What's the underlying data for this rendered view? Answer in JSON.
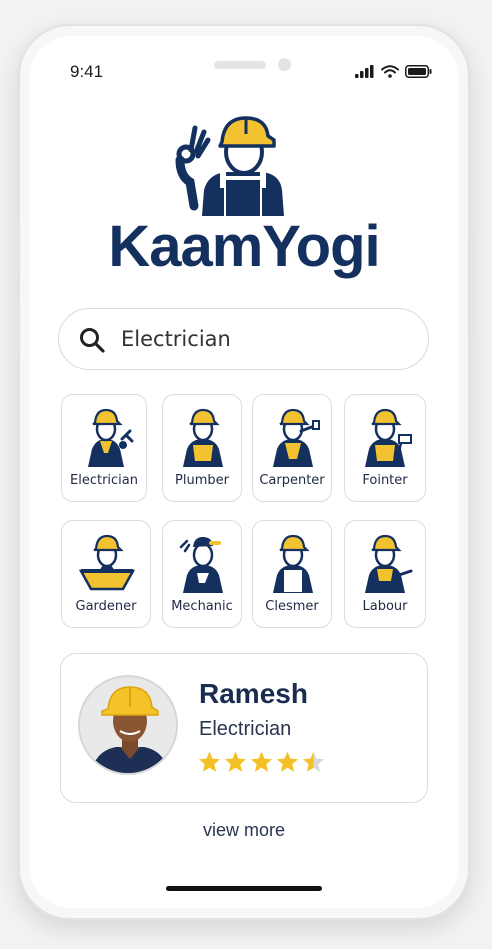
{
  "status_bar": {
    "time": "9:41"
  },
  "brand": {
    "name": "KaamYogi"
  },
  "search": {
    "value": "Electrician",
    "placeholder": "Electrician"
  },
  "categories": [
    {
      "label": "Electrician",
      "icon": "electrician-icon"
    },
    {
      "label": "Plumber",
      "icon": "plumber-icon"
    },
    {
      "label": "Carpenter",
      "icon": "carpenter-icon"
    },
    {
      "label": "Fointer",
      "icon": "painter-icon"
    },
    {
      "label": "Gardener",
      "icon": "gardener-icon"
    },
    {
      "label": "Mechanic",
      "icon": "mechanic-icon"
    },
    {
      "label": "Clesmer",
      "icon": "cleaner-icon"
    },
    {
      "label": "Labour",
      "icon": "labour-icon"
    }
  ],
  "featured_worker": {
    "name": "Ramesh",
    "role": "Electrician",
    "rating": 4.5,
    "rating_max": 5
  },
  "view_more": "view more",
  "colors": {
    "navy": "#14305e",
    "yellow": "#f2c230",
    "star": "#f5c026"
  }
}
